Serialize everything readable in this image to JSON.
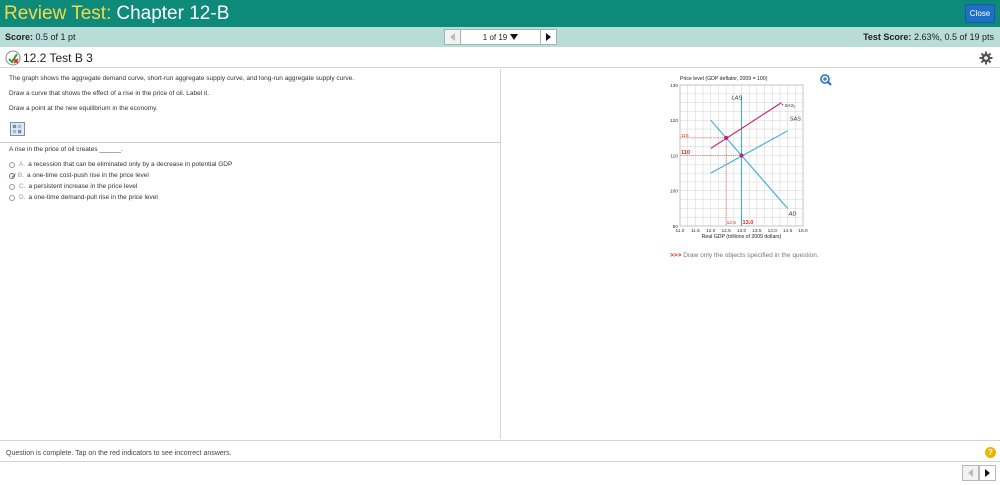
{
  "header": {
    "title_prefix": "Review Test:",
    "title_rest": "Chapter 12-B",
    "close_label": "Close"
  },
  "scorebar": {
    "score_label": "Score:",
    "score_value": "0.5 of 1 pt",
    "pager_text": "1 of 19",
    "test_score_label": "Test Score:",
    "test_score_value": "2.63%, 0.5 of 19 pts"
  },
  "question_header": {
    "title": "12.2 Test B 3"
  },
  "instructions": [
    "The graph shows the aggregate demand curve, short-run aggregate supply curve, and long-run aggregate supply curve.",
    "Draw a curve that shows the effect of a rise in the price of oil. Label it.",
    "Draw a point at the new equilibrium in the economy."
  ],
  "question": {
    "text": "A rise in the price of oil creates ______.",
    "options": [
      {
        "letter": "A.",
        "text": "a recession that can be eliminated only by a decrease in potential GDP",
        "selected": false
      },
      {
        "letter": "B.",
        "text": "a one-time cost-push rise in the price level",
        "selected": true
      },
      {
        "letter": "C.",
        "text": "a persistent increase in the price level",
        "selected": false
      },
      {
        "letter": "D.",
        "text": "a one-time demand-pull rise in the price level",
        "selected": false
      }
    ]
  },
  "chart_data": {
    "type": "line",
    "title": "Price level (GDP deflator, 2009 = 100)",
    "xlabel": "Real GDP (trillions of 2009 dollars)",
    "ylabel": "Price level (GDP deflator, 2009 = 100)",
    "xlim": [
      11.0,
      15.0
    ],
    "ylim": [
      90,
      130
    ],
    "x_ticks": [
      "11.0",
      "11.5",
      "12.0",
      "12.5",
      "13.0",
      "13.5",
      "14.0",
      "14.5",
      "15.0"
    ],
    "y_ticks": [
      "90",
      "100",
      "110",
      "120",
      "130"
    ],
    "grid": true,
    "series": [
      {
        "name": "LAS",
        "color": "#3aaed8",
        "points": [
          [
            13.0,
            90
          ],
          [
            13.0,
            127
          ]
        ]
      },
      {
        "name": "SAS",
        "color": "#3aaed8",
        "points": [
          [
            12.0,
            105
          ],
          [
            14.5,
            117
          ]
        ]
      },
      {
        "name": "AD",
        "color": "#3aaed8",
        "points": [
          [
            12.0,
            120
          ],
          [
            14.5,
            95
          ]
        ]
      },
      {
        "name": "SAS₁",
        "color": "#c8177a",
        "points": [
          [
            12.0,
            112
          ],
          [
            14.3,
            125
          ]
        ]
      }
    ],
    "points": [
      {
        "x": 12.5,
        "y": 115,
        "color": "#c8177a"
      },
      {
        "x": 13.0,
        "y": 110,
        "color": "#c8177a"
      }
    ],
    "annotations": [
      {
        "text": "115",
        "color": "#d9261c"
      },
      {
        "text": "110",
        "color": "#d9261c"
      },
      {
        "text": "12.5",
        "color": "#d9261c"
      },
      {
        "text": "13.0",
        "color": "#d9261c"
      }
    ]
  },
  "graph_note": {
    "prefix": ">>>",
    "text": "Draw only the objects specified in the question."
  },
  "footer": {
    "message": "Question is complete. Tap on the red indicators to see incorrect answers.",
    "help": "?"
  }
}
